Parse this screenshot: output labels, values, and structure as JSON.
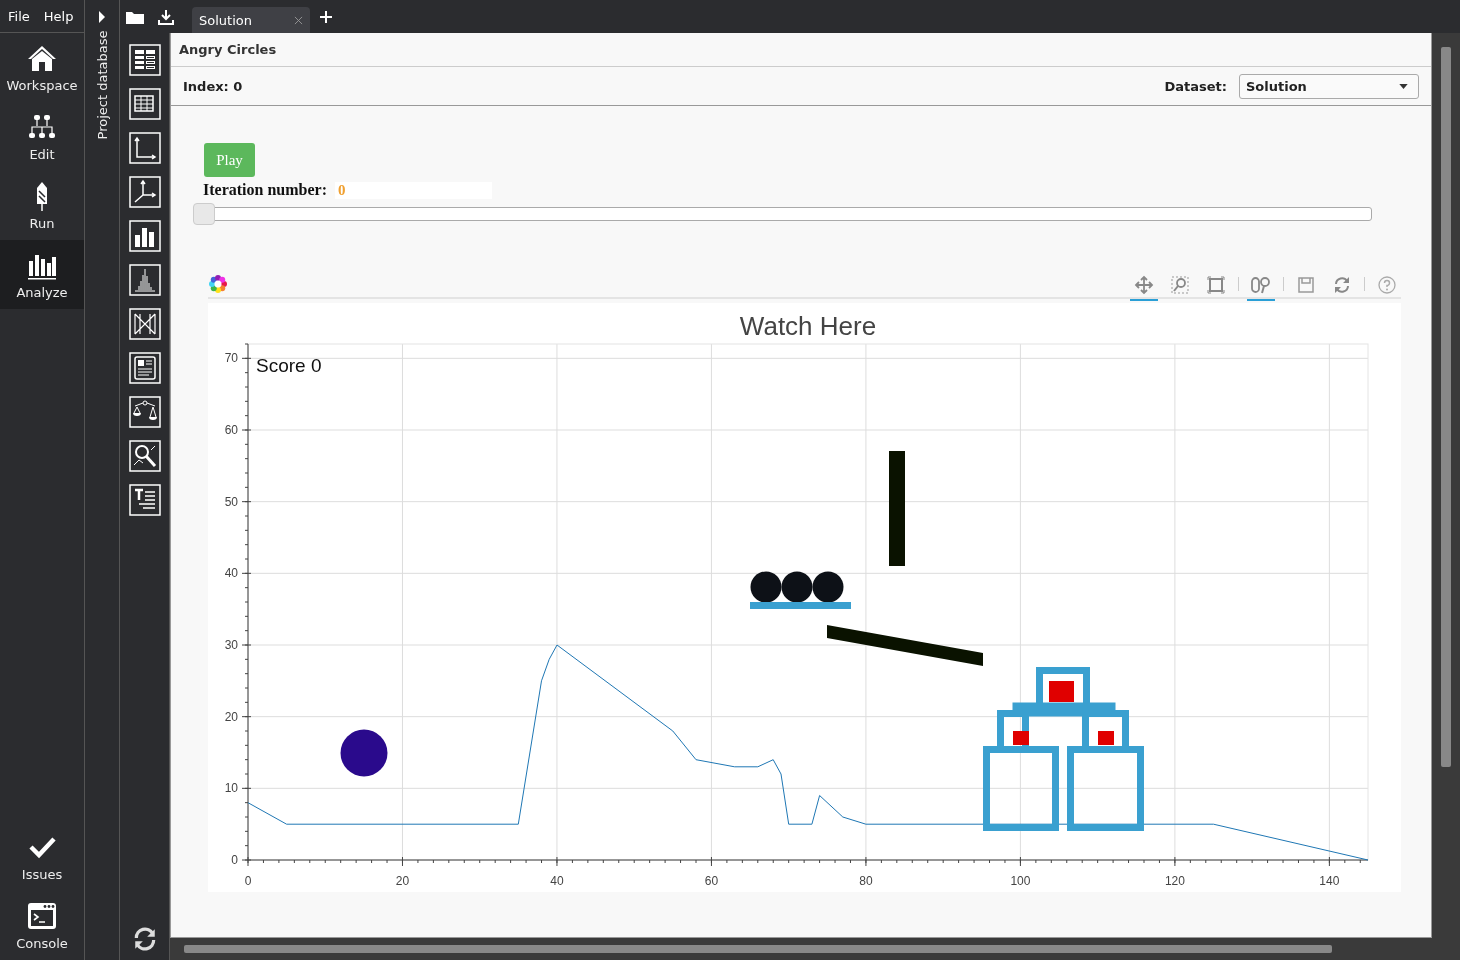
{
  "menu": [
    "File",
    "Help"
  ],
  "nav": [
    {
      "label": "Workspace",
      "selected": false
    },
    {
      "label": "Edit",
      "selected": false
    },
    {
      "label": "Run",
      "selected": false
    },
    {
      "label": "Analyze",
      "selected": true
    }
  ],
  "nav_bottom": [
    "Issues",
    "Console"
  ],
  "side_panel": {
    "title": "Project database",
    "collapsed": true
  },
  "tabs": [
    {
      "label": "Solution",
      "selected": true
    }
  ],
  "panel": {
    "title": "Angry Circles",
    "index_label": "Index: 0",
    "dataset_label": "Dataset:",
    "dataset_value": "Solution"
  },
  "player": {
    "play_button": "Play",
    "iteration_label": "Iteration number:",
    "iteration_value": "0",
    "slider": {
      "level": 0
    }
  },
  "plot_tools": [
    {
      "kind": "pan",
      "active": true
    },
    {
      "kind": "box_zoom",
      "active": false
    },
    {
      "kind": "reset_box",
      "active": false
    },
    {
      "kind": "wheel_zoom",
      "active": true
    },
    {
      "kind": "save",
      "active": false
    },
    {
      "kind": "reset",
      "active": false
    },
    {
      "kind": "help",
      "active": false
    }
  ],
  "chart_data": {
    "type": "line",
    "title": "Watch Here",
    "xlim": [
      0,
      145
    ],
    "ylim": [
      0,
      72
    ],
    "xticks": [
      0,
      20,
      40,
      60,
      80,
      100,
      120,
      140
    ],
    "yticks": [
      0,
      10,
      20,
      30,
      40,
      50,
      60,
      70
    ],
    "x": [
      0,
      5,
      35,
      38,
      39,
      40,
      55,
      58,
      63,
      66,
      68,
      69,
      70,
      73,
      74,
      77,
      80,
      125,
      145
    ],
    "series": [
      {
        "color": "#1f77b4",
        "values": [
          8,
          5,
          5,
          25,
          28,
          30,
          18,
          14,
          13,
          13,
          14,
          12,
          5,
          5,
          9,
          6,
          5,
          5,
          0
        ]
      }
    ],
    "grid": true,
    "annotations": [
      "Score 0"
    ]
  }
}
